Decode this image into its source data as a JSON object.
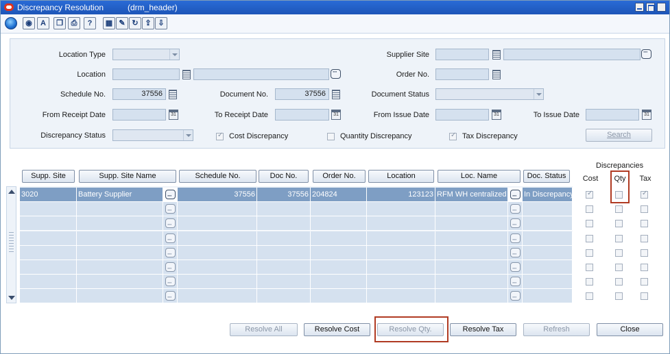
{
  "window": {
    "title": "Discrepancy Resolution",
    "subtitle": "(drm_header)"
  },
  "toolbar": {
    "icons": [
      "globe-icon",
      "help-index-icon",
      "spell-icon",
      "copy-icon",
      "print-icon",
      "help-icon",
      "table-icon",
      "edit-icon",
      "refresh-icon",
      "export-icon",
      "import-icon"
    ],
    "glyphs": {
      "help": "?",
      "spell": "A"
    }
  },
  "criteria": {
    "location_type": {
      "label": "Location Type",
      "value": ""
    },
    "supplier_site": {
      "label": "Supplier Site",
      "value": "",
      "name_value": ""
    },
    "location": {
      "label": "Location",
      "value": "",
      "name_value": ""
    },
    "order_no": {
      "label": "Order No.",
      "value": ""
    },
    "schedule_no": {
      "label": "Schedule No.",
      "value": "37556"
    },
    "document_no": {
      "label": "Document No.",
      "value": "37556"
    },
    "document_status": {
      "label": "Document Status",
      "value": ""
    },
    "from_receipt_date": {
      "label": "From Receipt Date",
      "value": ""
    },
    "to_receipt_date": {
      "label": "To Receipt Date",
      "value": ""
    },
    "from_issue_date": {
      "label": "From Issue Date",
      "value": ""
    },
    "to_issue_date": {
      "label": "To Issue Date",
      "value": ""
    },
    "discrepancy_status": {
      "label": "Discrepancy Status",
      "value": ""
    },
    "cost_discrepancy": {
      "label": "Cost Discrepancy",
      "checked": true
    },
    "quantity_discrepancy": {
      "label": "Quantity Discrepancy",
      "checked": false
    },
    "tax_discrepancy": {
      "label": "Tax Discrepancy",
      "checked": true
    },
    "search_label": "Search",
    "calendar_glyph": "31"
  },
  "table": {
    "columns": [
      "Supp. Site",
      "Supp. Site Name",
      "Schedule No.",
      "Doc No.",
      "Order No.",
      "Location",
      "Loc. Name",
      "Doc. Status"
    ],
    "discrepancies_header": "Discrepancies",
    "disc_columns": [
      "Cost",
      "Qty",
      "Tax"
    ],
    "rows": [
      {
        "supp_site": "3020",
        "supp_site_name": "Battery Supplier",
        "schedule_no": "37556",
        "doc_no": "37556",
        "order_no": "204824",
        "location": "123123",
        "loc_name": "RFM WH centralized",
        "doc_status": "In Discrepancy",
        "cost": true,
        "qty": false,
        "tax": true
      },
      {
        "supp_site": "",
        "supp_site_name": "",
        "schedule_no": "",
        "doc_no": "",
        "order_no": "",
        "location": "",
        "loc_name": "",
        "doc_status": "",
        "cost": false,
        "qty": false,
        "tax": false
      },
      {
        "supp_site": "",
        "supp_site_name": "",
        "schedule_no": "",
        "doc_no": "",
        "order_no": "",
        "location": "",
        "loc_name": "",
        "doc_status": "",
        "cost": false,
        "qty": false,
        "tax": false
      },
      {
        "supp_site": "",
        "supp_site_name": "",
        "schedule_no": "",
        "doc_no": "",
        "order_no": "",
        "location": "",
        "loc_name": "",
        "doc_status": "",
        "cost": false,
        "qty": false,
        "tax": false
      },
      {
        "supp_site": "",
        "supp_site_name": "",
        "schedule_no": "",
        "doc_no": "",
        "order_no": "",
        "location": "",
        "loc_name": "",
        "doc_status": "",
        "cost": false,
        "qty": false,
        "tax": false
      },
      {
        "supp_site": "",
        "supp_site_name": "",
        "schedule_no": "",
        "doc_no": "",
        "order_no": "",
        "location": "",
        "loc_name": "",
        "doc_status": "",
        "cost": false,
        "qty": false,
        "tax": false
      },
      {
        "supp_site": "",
        "supp_site_name": "",
        "schedule_no": "",
        "doc_no": "",
        "order_no": "",
        "location": "",
        "loc_name": "",
        "doc_status": "",
        "cost": false,
        "qty": false,
        "tax": false
      },
      {
        "supp_site": "",
        "supp_site_name": "",
        "schedule_no": "",
        "doc_no": "",
        "order_no": "",
        "location": "",
        "loc_name": "",
        "doc_status": "",
        "cost": false,
        "qty": false,
        "tax": false
      }
    ]
  },
  "buttons": {
    "resolve_all": {
      "label": "Resolve All",
      "enabled": false
    },
    "resolve_cost": {
      "label": "Resolve Cost",
      "enabled": true
    },
    "resolve_qty": {
      "label": "Resolve Qty.",
      "enabled": false
    },
    "resolve_tax": {
      "label": "Resolve Tax",
      "enabled": true
    },
    "refresh": {
      "label": "Refresh",
      "enabled": false
    },
    "close": {
      "label": "Close",
      "enabled": true
    }
  },
  "colors": {
    "titlebar": "#1d55b8",
    "field": "#d5e1ef",
    "selected_row": "#7e9ec4",
    "highlight": "#b03a22"
  }
}
